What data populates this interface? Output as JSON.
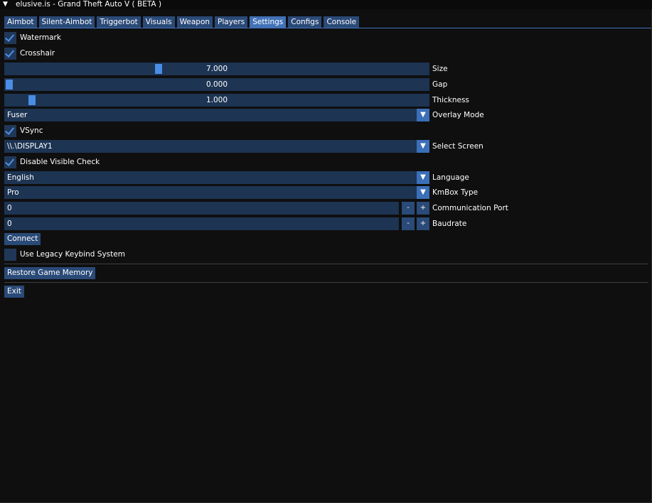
{
  "window": {
    "title": "elusive.is - Grand Theft Auto V ( BETA )",
    "collapse_glyph": "▼"
  },
  "tabs": [
    {
      "label": "Aimbot",
      "active": false
    },
    {
      "label": "Silent-Aimbot",
      "active": false
    },
    {
      "label": "Triggerbot",
      "active": false
    },
    {
      "label": "Visuals",
      "active": false
    },
    {
      "label": "Weapon",
      "active": false
    },
    {
      "label": "Players",
      "active": false
    },
    {
      "label": "Settings",
      "active": true
    },
    {
      "label": "Configs",
      "active": false
    },
    {
      "label": "Console",
      "active": false
    }
  ],
  "settings": {
    "watermark": {
      "label": "Watermark",
      "checked": true
    },
    "crosshair": {
      "label": "Crosshair",
      "checked": true
    },
    "size": {
      "label": "Size",
      "value": "7.000",
      "fraction": 0.36
    },
    "gap": {
      "label": "Gap",
      "value": "0.000",
      "fraction": 0.0
    },
    "thickness": {
      "label": "Thickness",
      "value": "1.000",
      "fraction": 0.055
    },
    "overlay_mode": {
      "label": "Overlay Mode",
      "value": "Fuser"
    },
    "vsync": {
      "label": "VSync",
      "checked": true
    },
    "select_screen": {
      "label": "Select Screen",
      "value": "\\\\.\\DISPLAY1"
    },
    "disable_visible_check": {
      "label": "Disable Visible Check",
      "checked": true
    },
    "language": {
      "label": "Language",
      "value": "English"
    },
    "kmbox_type": {
      "label": "KmBox Type",
      "value": "Pro"
    },
    "communication_port": {
      "label": "Communication Port",
      "value": "0"
    },
    "baudrate": {
      "label": "Baudrate",
      "value": "0"
    },
    "connect_label": "Connect",
    "legacy_keybind": {
      "label": "Use Legacy Keybind System",
      "checked": false
    },
    "restore_label": "Restore Game Memory",
    "exit_label": "Exit"
  },
  "glyphs": {
    "dropdown": "▼",
    "minus": "-",
    "plus": "+"
  },
  "colors": {
    "background": "#0f0f0f",
    "frame": "#1d3453",
    "button": "#2a4a78",
    "active_tab": "#4272b8",
    "accent": "#4a8de4"
  }
}
